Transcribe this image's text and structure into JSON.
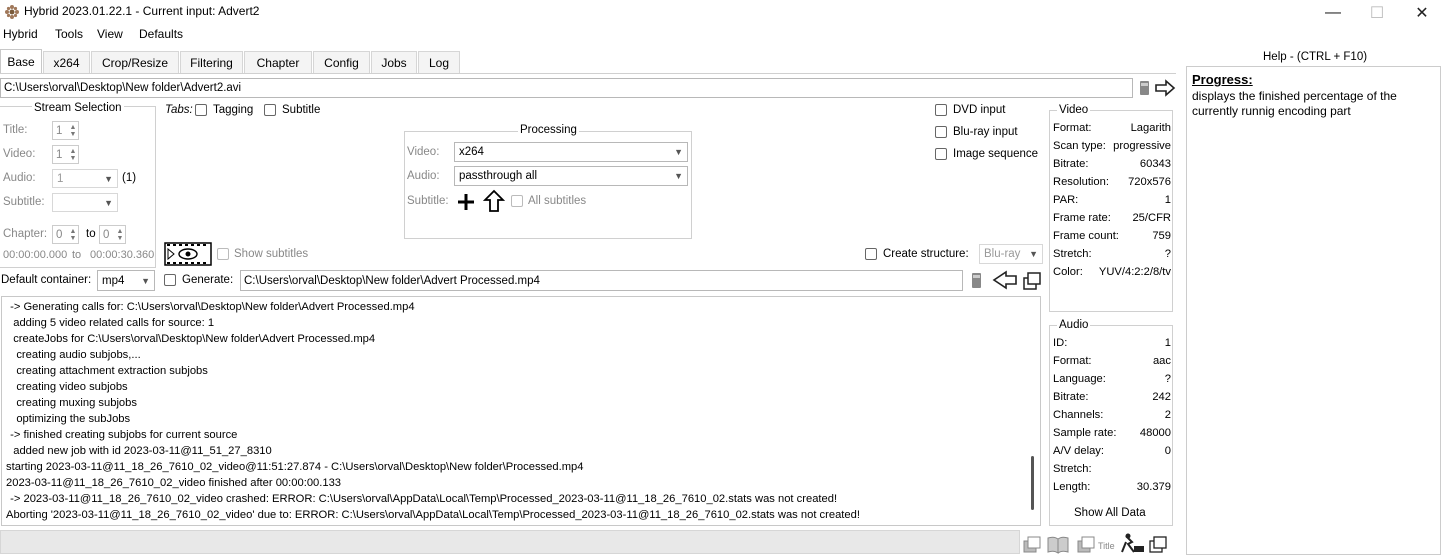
{
  "window": {
    "title": "Hybrid 2023.01.22.1 - Current input: Advert2",
    "minimize": "—",
    "maximize": "☐",
    "close": "✕"
  },
  "menu": [
    "Hybrid",
    "Tools",
    "View",
    "Defaults"
  ],
  "tabs": [
    "Base",
    "x264",
    "Crop/Resize",
    "Filtering",
    "Chapter",
    "Config",
    "Jobs",
    "Log"
  ],
  "input_path": "C:\\Users\\orval\\Desktop\\New folder\\Advert2.avi",
  "stream_selection": {
    "title": "Stream Selection",
    "title_label": "Title:",
    "title_value": "1",
    "video_label": "Video:",
    "video_value": "1",
    "audio_label": "Audio:",
    "audio_value": "1",
    "audio_count": "(1)",
    "subtitle_label": "Subtitle:",
    "chapter_label": "Chapter:",
    "chapter_from": "0",
    "chapter_to_label": "to",
    "chapter_to": "0",
    "time_from": "00:00:00.000",
    "time_to_label": "to",
    "time_to": "00:00:30.360"
  },
  "tabs_options": {
    "label": "Tabs:",
    "tagging": "Tagging",
    "subtitle": "Subtitle"
  },
  "processing": {
    "title": "Processing",
    "video_label": "Video:",
    "video_value": "x264",
    "audio_label": "Audio:",
    "audio_value": "passthrough all",
    "subtitle_label": "Subtitle:",
    "all_subtitles": "All subtitles"
  },
  "input_options": {
    "dvd": "DVD input",
    "bluray": "Blu-ray input",
    "image_seq": "Image sequence"
  },
  "show_subtitles": "Show subtitles",
  "create_structure": {
    "label": "Create structure:",
    "value": "Blu-ray"
  },
  "output": {
    "container_label": "Default container:",
    "container_value": "mp4",
    "generate_label": "Generate:",
    "path": "C:\\Users\\orval\\Desktop\\New folder\\Advert Processed.mp4"
  },
  "video_info": {
    "title": "Video",
    "rows": [
      {
        "k": "Format:",
        "v": "Lagarith"
      },
      {
        "k": "Scan type:",
        "v": "progressive"
      },
      {
        "k": "Bitrate:",
        "v": "60343"
      },
      {
        "k": "Resolution:",
        "v": "720x576"
      },
      {
        "k": "PAR:",
        "v": "1"
      },
      {
        "k": "Frame rate:",
        "v": "25/CFR"
      },
      {
        "k": "Frame count:",
        "v": "759"
      },
      {
        "k": "Stretch:",
        "v": "?"
      },
      {
        "k": "Color:",
        "v": "YUV/4:2:2/8/tv"
      }
    ]
  },
  "audio_info": {
    "title": "Audio",
    "rows": [
      {
        "k": "ID:",
        "v": "1"
      },
      {
        "k": "Format:",
        "v": "aac"
      },
      {
        "k": "Language:",
        "v": "?"
      },
      {
        "k": "Bitrate:",
        "v": "242"
      },
      {
        "k": "Channels:",
        "v": "2"
      },
      {
        "k": "Sample rate:",
        "v": "48000"
      },
      {
        "k": "A/V delay:",
        "v": "0"
      },
      {
        "k": "Stretch:",
        "v": ""
      },
      {
        "k": "Length:",
        "v": "30.379"
      }
    ],
    "show_all": "Show All Data"
  },
  "log_lines": [
    " -> Generating calls for: C:\\Users\\orval\\Desktop\\New folder\\Advert Processed.mp4",
    "  adding 5 video related calls for source: 1",
    "  createJobs for C:\\Users\\orval\\Desktop\\New folder\\Advert Processed.mp4",
    "   creating audio subjobs,...",
    "   creating attachment extraction subjobs",
    "   creating video subjobs",
    "   creating muxing subjobs",
    "   optimizing the subJobs",
    " -> finished creating subjobs for current source",
    "  added new job with id 2023-03-11@11_51_27_8310",
    "starting 2023-03-11@11_18_26_7610_02_video@11:51:27.874 - C:\\Users\\orval\\Desktop\\New folder\\Processed.mp4",
    "2023-03-11@11_18_26_7610_02_video finished after 00:00:00.133",
    " -> 2023-03-11@11_18_26_7610_02_video crashed: ERROR: C:\\Users\\orval\\AppData\\Local\\Temp\\Processed_2023-03-11@11_18_26_7610_02.stats was not created!",
    "Aborting '2023-03-11@11_18_26_7610_02_video' due to: ERROR: C:\\Users\\orval\\AppData\\Local\\Temp\\Processed_2023-03-11@11_18_26_7610_02.stats was not created!"
  ],
  "help": {
    "title": "Help - (CTRL + F10)",
    "heading": "Progress:",
    "text": "displays the finished percentage of the currently runnig encoding part"
  },
  "status_icons": {
    "title_label": "Title"
  }
}
